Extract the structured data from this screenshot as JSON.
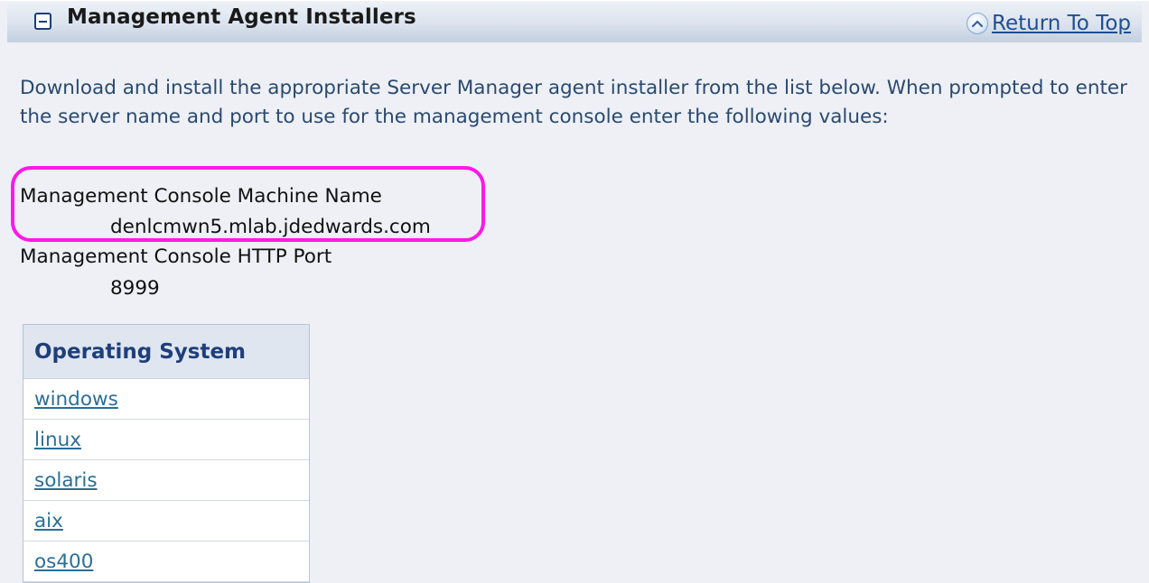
{
  "section": {
    "title": "Management Agent Installers",
    "return_label": "Return To Top"
  },
  "intro": {
    "text": "Download and install the appropriate Server Manager agent installer from the list below. When prompted to enter the server name and port to use for the management console enter the following values:"
  },
  "console": {
    "machine_name_label": "Management Console Machine Name",
    "machine_name_value": "denlcmwn5.mlab.jdedwards.com",
    "port_label": "Management Console HTTP Port",
    "port_value": "8999"
  },
  "os_table": {
    "header": "Operating System",
    "rows": [
      {
        "label": "windows"
      },
      {
        "label": "linux"
      },
      {
        "label": "solaris"
      },
      {
        "label": "aix"
      },
      {
        "label": "os400"
      }
    ]
  },
  "colors": {
    "highlight": "#ff19e8",
    "link": "#2b6e96",
    "header_text": "#1f3f7a",
    "intro_text": "#2a4a6f"
  },
  "icons": {
    "collapse": "collapse-minus-icon",
    "return_top": "chevron-up-icon"
  }
}
